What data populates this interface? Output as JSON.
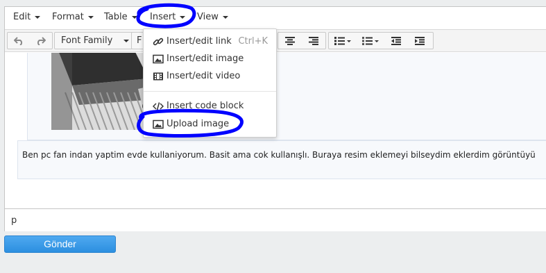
{
  "menubar": {
    "items": [
      {
        "label": "Edit"
      },
      {
        "label": "Format"
      },
      {
        "label": "Table"
      },
      {
        "label": "Insert"
      },
      {
        "label": "View"
      }
    ]
  },
  "toolbar": {
    "font_family_label": "Font Family",
    "font_size_label": "F",
    "icons": [
      "undo-icon",
      "redo-icon",
      "align-center-icon",
      "align-right-icon",
      "bullet-list-icon",
      "numbered-list-icon",
      "outdent-icon",
      "indent-icon"
    ]
  },
  "insert_menu": {
    "items": [
      {
        "label": "Insert/edit link",
        "shortcut": "Ctrl+K",
        "icon": "link-icon"
      },
      {
        "label": "Insert/edit image",
        "icon": "image-icon"
      },
      {
        "label": "Insert/edit video",
        "icon": "video-icon"
      },
      {
        "label": "Insert code block",
        "icon": "code-icon"
      },
      {
        "label": "Upload image",
        "icon": "upload-image-icon"
      }
    ]
  },
  "content": {
    "paragraph": "Ben pc fan indan yaptim evde kullaniyorum. Basit ama cok kullanışlı.  Buraya resim eklemeyi bilseydim eklerdim görüntüyü"
  },
  "statusbar": {
    "path": "p"
  },
  "submit_label": "Gönder",
  "colors": {
    "accent": "#2c8fe0",
    "annotation": "#0000ff"
  }
}
